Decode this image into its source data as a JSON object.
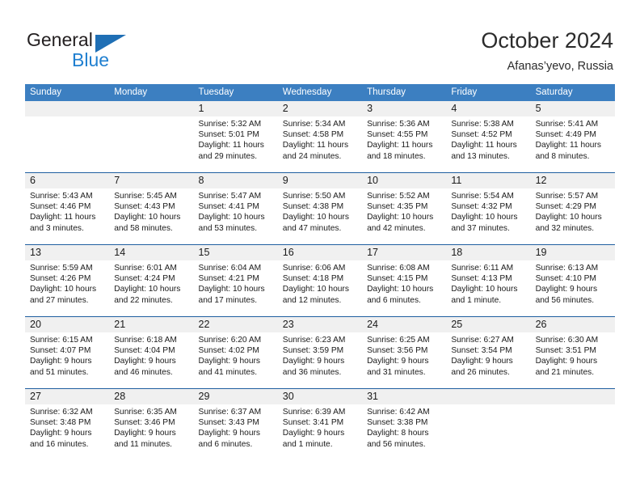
{
  "brand": {
    "name_top": "General",
    "name_bottom": "Blue",
    "triangle_color": "#1f6fb5",
    "blue_color": "#1f7fd0"
  },
  "header": {
    "title": "October 2024",
    "subtitle": "Afanas’yevo, Russia"
  },
  "theme": {
    "header_bar_color": "#3c7fc1",
    "week_divider_color": "#1f5fa0",
    "day_strip_color": "#f0f0f0"
  },
  "weekdays": [
    "Sunday",
    "Monday",
    "Tuesday",
    "Wednesday",
    "Thursday",
    "Friday",
    "Saturday"
  ],
  "weeks": [
    {
      "days": [
        {
          "num": "",
          "empty": true
        },
        {
          "num": "",
          "empty": true
        },
        {
          "num": "1",
          "sunrise": "Sunrise: 5:32 AM",
          "sunset": "Sunset: 5:01 PM",
          "daylight1": "Daylight: 11 hours",
          "daylight2": "and 29 minutes."
        },
        {
          "num": "2",
          "sunrise": "Sunrise: 5:34 AM",
          "sunset": "Sunset: 4:58 PM",
          "daylight1": "Daylight: 11 hours",
          "daylight2": "and 24 minutes."
        },
        {
          "num": "3",
          "sunrise": "Sunrise: 5:36 AM",
          "sunset": "Sunset: 4:55 PM",
          "daylight1": "Daylight: 11 hours",
          "daylight2": "and 18 minutes."
        },
        {
          "num": "4",
          "sunrise": "Sunrise: 5:38 AM",
          "sunset": "Sunset: 4:52 PM",
          "daylight1": "Daylight: 11 hours",
          "daylight2": "and 13 minutes."
        },
        {
          "num": "5",
          "sunrise": "Sunrise: 5:41 AM",
          "sunset": "Sunset: 4:49 PM",
          "daylight1": "Daylight: 11 hours",
          "daylight2": "and 8 minutes."
        }
      ]
    },
    {
      "days": [
        {
          "num": "6",
          "sunrise": "Sunrise: 5:43 AM",
          "sunset": "Sunset: 4:46 PM",
          "daylight1": "Daylight: 11 hours",
          "daylight2": "and 3 minutes."
        },
        {
          "num": "7",
          "sunrise": "Sunrise: 5:45 AM",
          "sunset": "Sunset: 4:43 PM",
          "daylight1": "Daylight: 10 hours",
          "daylight2": "and 58 minutes."
        },
        {
          "num": "8",
          "sunrise": "Sunrise: 5:47 AM",
          "sunset": "Sunset: 4:41 PM",
          "daylight1": "Daylight: 10 hours",
          "daylight2": "and 53 minutes."
        },
        {
          "num": "9",
          "sunrise": "Sunrise: 5:50 AM",
          "sunset": "Sunset: 4:38 PM",
          "daylight1": "Daylight: 10 hours",
          "daylight2": "and 47 minutes."
        },
        {
          "num": "10",
          "sunrise": "Sunrise: 5:52 AM",
          "sunset": "Sunset: 4:35 PM",
          "daylight1": "Daylight: 10 hours",
          "daylight2": "and 42 minutes."
        },
        {
          "num": "11",
          "sunrise": "Sunrise: 5:54 AM",
          "sunset": "Sunset: 4:32 PM",
          "daylight1": "Daylight: 10 hours",
          "daylight2": "and 37 minutes."
        },
        {
          "num": "12",
          "sunrise": "Sunrise: 5:57 AM",
          "sunset": "Sunset: 4:29 PM",
          "daylight1": "Daylight: 10 hours",
          "daylight2": "and 32 minutes."
        }
      ]
    },
    {
      "days": [
        {
          "num": "13",
          "sunrise": "Sunrise: 5:59 AM",
          "sunset": "Sunset: 4:26 PM",
          "daylight1": "Daylight: 10 hours",
          "daylight2": "and 27 minutes."
        },
        {
          "num": "14",
          "sunrise": "Sunrise: 6:01 AM",
          "sunset": "Sunset: 4:24 PM",
          "daylight1": "Daylight: 10 hours",
          "daylight2": "and 22 minutes."
        },
        {
          "num": "15",
          "sunrise": "Sunrise: 6:04 AM",
          "sunset": "Sunset: 4:21 PM",
          "daylight1": "Daylight: 10 hours",
          "daylight2": "and 17 minutes."
        },
        {
          "num": "16",
          "sunrise": "Sunrise: 6:06 AM",
          "sunset": "Sunset: 4:18 PM",
          "daylight1": "Daylight: 10 hours",
          "daylight2": "and 12 minutes."
        },
        {
          "num": "17",
          "sunrise": "Sunrise: 6:08 AM",
          "sunset": "Sunset: 4:15 PM",
          "daylight1": "Daylight: 10 hours",
          "daylight2": "and 6 minutes."
        },
        {
          "num": "18",
          "sunrise": "Sunrise: 6:11 AM",
          "sunset": "Sunset: 4:13 PM",
          "daylight1": "Daylight: 10 hours",
          "daylight2": "and 1 minute."
        },
        {
          "num": "19",
          "sunrise": "Sunrise: 6:13 AM",
          "sunset": "Sunset: 4:10 PM",
          "daylight1": "Daylight: 9 hours",
          "daylight2": "and 56 minutes."
        }
      ]
    },
    {
      "days": [
        {
          "num": "20",
          "sunrise": "Sunrise: 6:15 AM",
          "sunset": "Sunset: 4:07 PM",
          "daylight1": "Daylight: 9 hours",
          "daylight2": "and 51 minutes."
        },
        {
          "num": "21",
          "sunrise": "Sunrise: 6:18 AM",
          "sunset": "Sunset: 4:04 PM",
          "daylight1": "Daylight: 9 hours",
          "daylight2": "and 46 minutes."
        },
        {
          "num": "22",
          "sunrise": "Sunrise: 6:20 AM",
          "sunset": "Sunset: 4:02 PM",
          "daylight1": "Daylight: 9 hours",
          "daylight2": "and 41 minutes."
        },
        {
          "num": "23",
          "sunrise": "Sunrise: 6:23 AM",
          "sunset": "Sunset: 3:59 PM",
          "daylight1": "Daylight: 9 hours",
          "daylight2": "and 36 minutes."
        },
        {
          "num": "24",
          "sunrise": "Sunrise: 6:25 AM",
          "sunset": "Sunset: 3:56 PM",
          "daylight1": "Daylight: 9 hours",
          "daylight2": "and 31 minutes."
        },
        {
          "num": "25",
          "sunrise": "Sunrise: 6:27 AM",
          "sunset": "Sunset: 3:54 PM",
          "daylight1": "Daylight: 9 hours",
          "daylight2": "and 26 minutes."
        },
        {
          "num": "26",
          "sunrise": "Sunrise: 6:30 AM",
          "sunset": "Sunset: 3:51 PM",
          "daylight1": "Daylight: 9 hours",
          "daylight2": "and 21 minutes."
        }
      ]
    },
    {
      "days": [
        {
          "num": "27",
          "sunrise": "Sunrise: 6:32 AM",
          "sunset": "Sunset: 3:48 PM",
          "daylight1": "Daylight: 9 hours",
          "daylight2": "and 16 minutes."
        },
        {
          "num": "28",
          "sunrise": "Sunrise: 6:35 AM",
          "sunset": "Sunset: 3:46 PM",
          "daylight1": "Daylight: 9 hours",
          "daylight2": "and 11 minutes."
        },
        {
          "num": "29",
          "sunrise": "Sunrise: 6:37 AM",
          "sunset": "Sunset: 3:43 PM",
          "daylight1": "Daylight: 9 hours",
          "daylight2": "and 6 minutes."
        },
        {
          "num": "30",
          "sunrise": "Sunrise: 6:39 AM",
          "sunset": "Sunset: 3:41 PM",
          "daylight1": "Daylight: 9 hours",
          "daylight2": "and 1 minute."
        },
        {
          "num": "31",
          "sunrise": "Sunrise: 6:42 AM",
          "sunset": "Sunset: 3:38 PM",
          "daylight1": "Daylight: 8 hours",
          "daylight2": "and 56 minutes."
        },
        {
          "num": "",
          "empty": true
        },
        {
          "num": "",
          "empty": true
        }
      ]
    }
  ]
}
